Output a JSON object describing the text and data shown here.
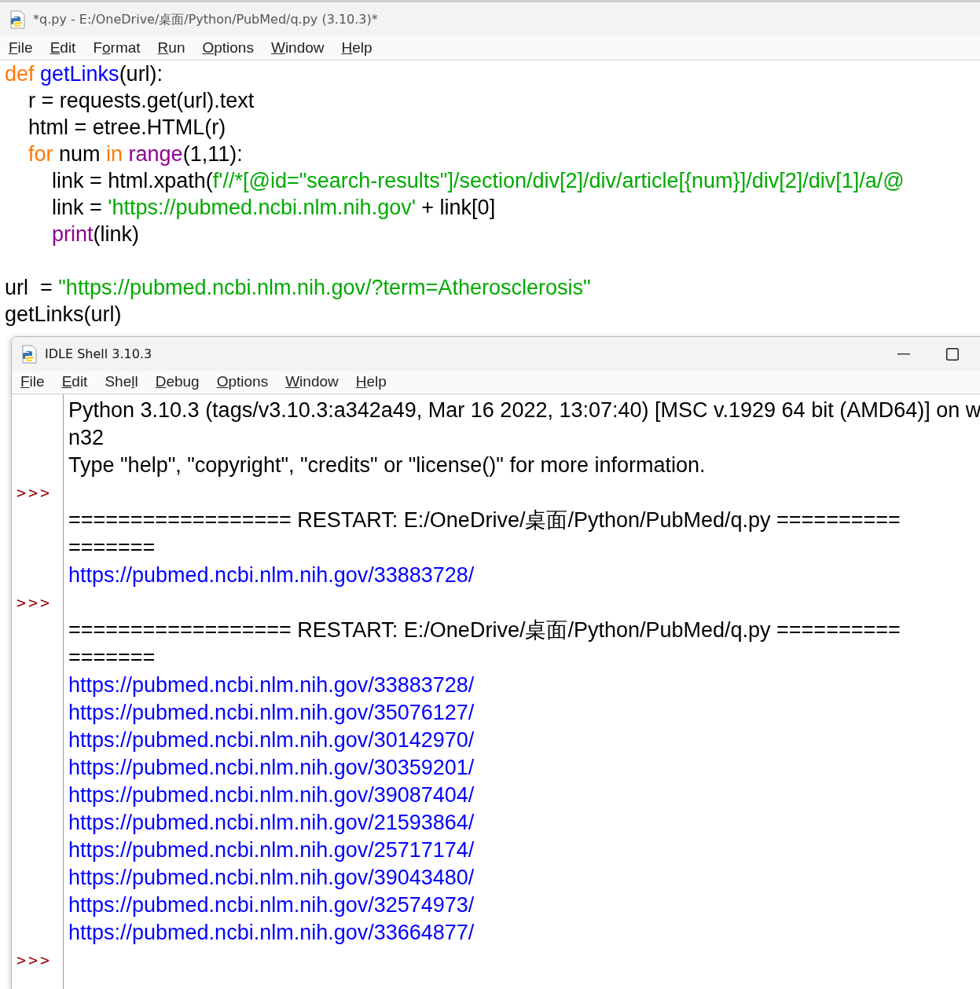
{
  "editor": {
    "title": "*q.py - E:/OneDrive/桌面/Python/PubMed/q.py (3.10.3)*",
    "menu": [
      {
        "key": "F",
        "after": "ile"
      },
      {
        "key": "E",
        "after": "dit"
      },
      {
        "before": "F",
        "key": "o",
        "after": "rmat"
      },
      {
        "key": "R",
        "after": "un"
      },
      {
        "key": "O",
        "after": "ptions"
      },
      {
        "key": "W",
        "after": "indow"
      },
      {
        "key": "H",
        "after": "elp"
      }
    ],
    "code_lines": [
      {
        "kind": "code",
        "tokens": [
          {
            "kind": "keyword",
            "text": "def "
          },
          {
            "kind": "defname",
            "text": "getLinks"
          },
          {
            "kind": "plain",
            "text": "(url):"
          }
        ]
      },
      {
        "kind": "code",
        "tokens": [
          {
            "kind": "plain",
            "text": "    r = requests.get(url).text"
          }
        ]
      },
      {
        "kind": "code",
        "tokens": [
          {
            "kind": "plain",
            "text": "    html = etree.HTML(r)"
          }
        ]
      },
      {
        "kind": "code",
        "tokens": [
          {
            "kind": "keyword",
            "text": "    for"
          },
          {
            "kind": "plain",
            "text": " num "
          },
          {
            "kind": "keyword",
            "text": "in "
          },
          {
            "kind": "builtin",
            "text": "range"
          },
          {
            "kind": "plain",
            "text": "(1,11):"
          }
        ]
      },
      {
        "kind": "code",
        "tokens": [
          {
            "kind": "plain",
            "text": "        link = html.xpath("
          },
          {
            "kind": "string",
            "text": "f'//*[@id=\"search-results\"]/section/div[2]/div/article[{num}]/div[2]/div[1]/a/@"
          }
        ]
      },
      {
        "kind": "code",
        "tokens": [
          {
            "kind": "plain",
            "text": "        link = "
          },
          {
            "kind": "string",
            "text": "'https://pubmed.ncbi.nlm.nih.gov'"
          },
          {
            "kind": "plain",
            "text": " + link[0]"
          }
        ]
      },
      {
        "kind": "code",
        "tokens": [
          {
            "kind": "builtin",
            "text": "        print"
          },
          {
            "kind": "plain",
            "text": "(link)"
          }
        ]
      },
      {
        "kind": "blank"
      },
      {
        "kind": "code",
        "tokens": [
          {
            "kind": "plain",
            "text": "url  = "
          },
          {
            "kind": "string",
            "text": "\"https://pubmed.ncbi.nlm.nih.gov/?term=Atherosclerosis\""
          }
        ]
      },
      {
        "kind": "code",
        "tokens": [
          {
            "kind": "plain",
            "text": "getLinks(url)"
          }
        ]
      }
    ]
  },
  "shell": {
    "title": "IDLE Shell 3.10.3",
    "menu": [
      {
        "key": "F",
        "after": "ile"
      },
      {
        "key": "E",
        "after": "dit"
      },
      {
        "before": "She",
        "key": "l",
        "after": "l"
      },
      {
        "key": "D",
        "after": "ebug"
      },
      {
        "key": "O",
        "after": "ptions"
      },
      {
        "key": "W",
        "after": "indow"
      },
      {
        "key": "H",
        "after": "elp"
      }
    ],
    "lines": [
      {
        "kind": "plain",
        "text": "Python 3.10.3 (tags/v3.10.3:a342a49, Mar 16 2022, 13:07:40) [MSC v.1929 64 bit (AMD64)] on w"
      },
      {
        "kind": "plain",
        "text": "n32"
      },
      {
        "kind": "plain",
        "text": "Type \"help\", \"copyright\", \"credits\" or \"license()\" for more information."
      },
      {
        "kind": "prompt",
        "prompt": ">>>"
      },
      {
        "kind": "plain",
        "text": "================== RESTART: E:/OneDrive/桌面/Python/PubMed/q.py =========="
      },
      {
        "kind": "plain",
        "text": "======="
      },
      {
        "kind": "stdout",
        "text": "https://pubmed.ncbi.nlm.nih.gov/33883728/"
      },
      {
        "kind": "prompt",
        "prompt": ">>>"
      },
      {
        "kind": "plain",
        "text": "================== RESTART: E:/OneDrive/桌面/Python/PubMed/q.py =========="
      },
      {
        "kind": "plain",
        "text": "======="
      },
      {
        "kind": "stdout",
        "text": "https://pubmed.ncbi.nlm.nih.gov/33883728/"
      },
      {
        "kind": "stdout",
        "text": "https://pubmed.ncbi.nlm.nih.gov/35076127/"
      },
      {
        "kind": "stdout",
        "text": "https://pubmed.ncbi.nlm.nih.gov/30142970/"
      },
      {
        "kind": "stdout",
        "text": "https://pubmed.ncbi.nlm.nih.gov/30359201/"
      },
      {
        "kind": "stdout",
        "text": "https://pubmed.ncbi.nlm.nih.gov/39087404/"
      },
      {
        "kind": "stdout",
        "text": "https://pubmed.ncbi.nlm.nih.gov/21593864/"
      },
      {
        "kind": "stdout",
        "text": "https://pubmed.ncbi.nlm.nih.gov/25717174/"
      },
      {
        "kind": "stdout",
        "text": "https://pubmed.ncbi.nlm.nih.gov/39043480/"
      },
      {
        "kind": "stdout",
        "text": "https://pubmed.ncbi.nlm.nih.gov/32574973/"
      },
      {
        "kind": "stdout",
        "text": "https://pubmed.ncbi.nlm.nih.gov/33664877/"
      },
      {
        "kind": "prompt",
        "prompt": ">>>"
      }
    ]
  }
}
